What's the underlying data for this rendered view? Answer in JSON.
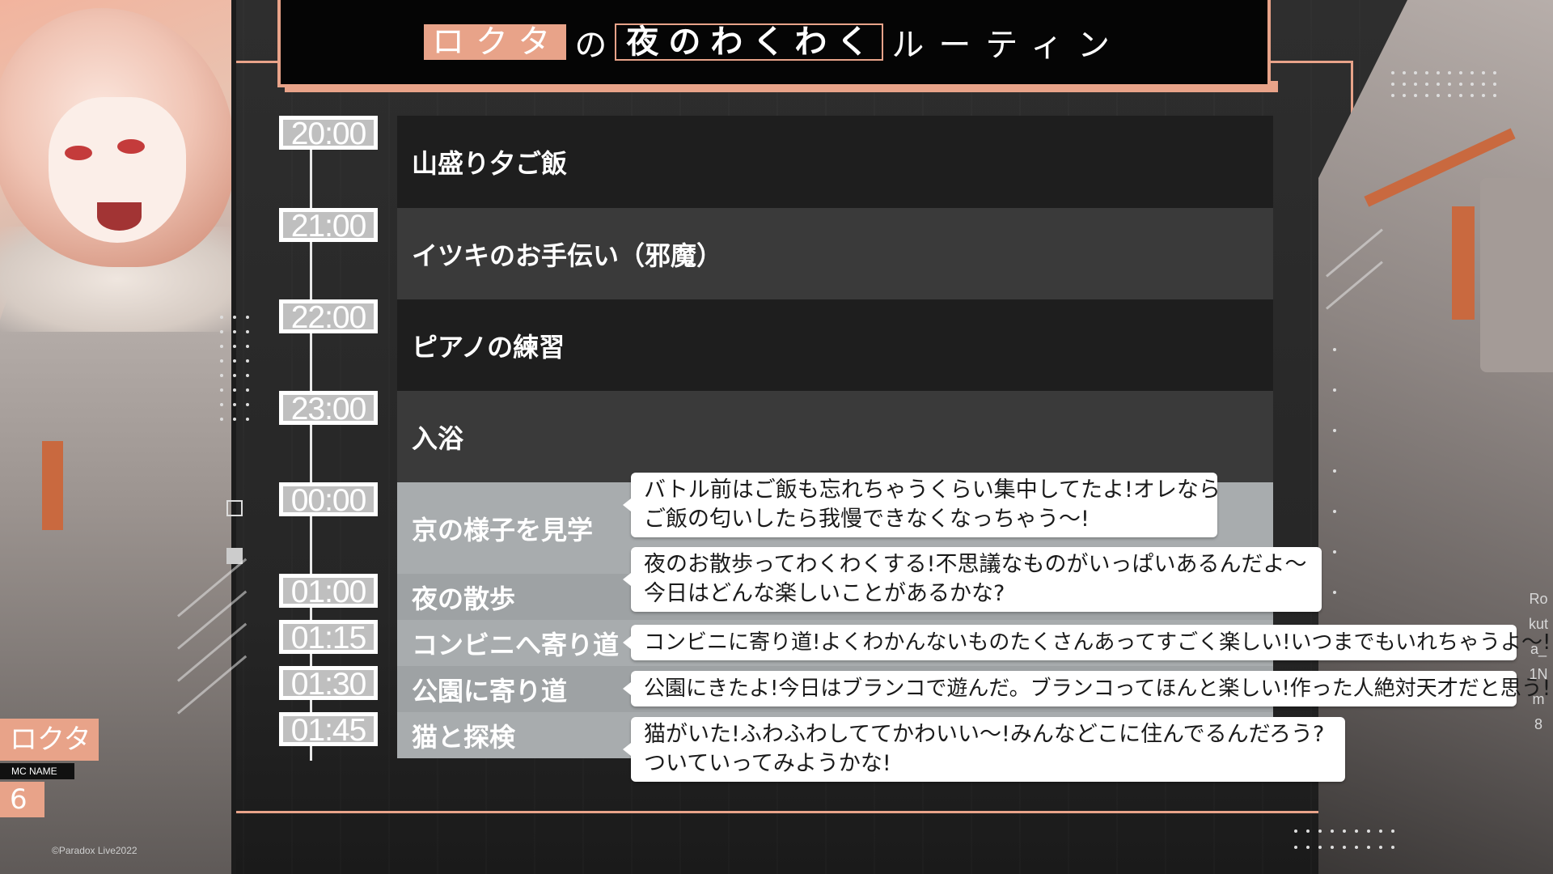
{
  "title": {
    "name": "ロクタ",
    "particle": "の",
    "highlight": "夜のわくわく",
    "suffix": "ルーティン"
  },
  "schedule": [
    {
      "time": "20:00",
      "activity": "山盛り夕ご飯"
    },
    {
      "time": "21:00",
      "activity": "イツキのお手伝い（邪魔）"
    },
    {
      "time": "22:00",
      "activity": "ピアノの練習"
    },
    {
      "time": "23:00",
      "activity": "入浴"
    },
    {
      "time": "00:00",
      "activity": "京の様子を見学"
    },
    {
      "time": "01:00",
      "activity": "夜の散歩"
    },
    {
      "time": "01:15",
      "activity": "コンビニへ寄り道"
    },
    {
      "time": "01:30",
      "activity": "公園に寄り道"
    },
    {
      "time": "01:45",
      "activity": "猫と探検"
    }
  ],
  "comments": [
    {
      "line1": "バトル前はご飯も忘れちゃうくらい集中してたよ!オレなら",
      "line2": "ご飯の匂いしたら我慢できなくなっちゃう〜!"
    },
    {
      "line1": "夜のお散歩ってわくわくする!不思議なものがいっぱいあるんだよ〜",
      "line2": "今日はどんな楽しいことがあるかな?"
    },
    {
      "line1": "コンビニに寄り道!よくわかんないものたくさんあってすごく楽しい!いつまでもいれちゃうよ〜!",
      "line2": ""
    },
    {
      "line1": "公園にきたよ!今日はブランコで遊んだ。ブランコってほんと楽しい!作った人絶対天才だと思う!",
      "line2": ""
    },
    {
      "line1": "猫がいた!ふわふわしててかわいい〜!みんなどこに住んでるんだろう?",
      "line2": "ついていってみようかな!"
    }
  ],
  "badge": {
    "name": "ロクタ",
    "label": "MC NAME",
    "number": "6"
  },
  "copyright": "©Paradox Live2022",
  "side_text": "Rokuta_1Nm8",
  "colors": {
    "accent": "#e8a389",
    "row_dark": "#1e1e1e",
    "row_mid": "#3a3a3a",
    "row_light": "#a8acae",
    "background": "#2b2b2b"
  }
}
